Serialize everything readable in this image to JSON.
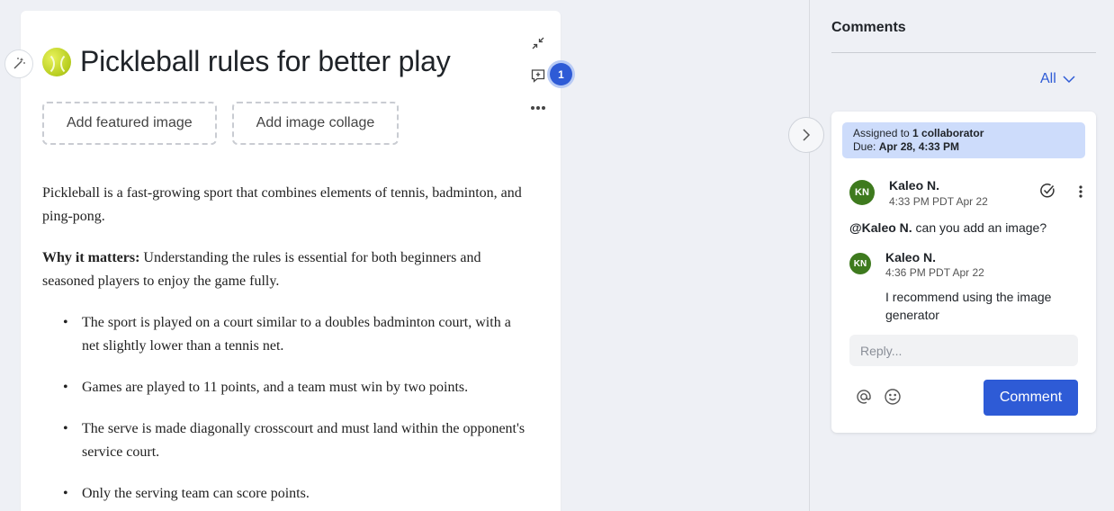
{
  "editor": {
    "title": "Pickleball rules for better play",
    "add_featured_image": "Add featured image",
    "add_image_collage": "Add image collage",
    "comment_count": "1",
    "intro": "Pickleball is a fast-growing sport that combines elements of tennis, badminton, and ping-pong.",
    "why_label": "Why it matters:",
    "why_text": " Understanding the rules is essential for both beginners and seasoned players to enjoy the game fully.",
    "bullets": [
      "The sport is played on a court similar to a doubles badminton court, with a net slightly lower than a tennis net.",
      "Games are played to 11 points, and a team must win by two points.",
      "The serve is made diagonally crosscourt and must land within the opponent's service court.",
      "Only the serving team can score points."
    ]
  },
  "comments": {
    "title": "Comments",
    "filter": "All",
    "assignment": {
      "prefix": "Assigned to ",
      "collaborators": "1 collaborator",
      "due_label": "Due: ",
      "due_date": "Apr 28, 4:33 PM"
    },
    "thread": [
      {
        "initials": "KN",
        "author": "Kaleo N.",
        "time": "4:33 PM PDT Apr 22",
        "mention": "@Kaleo N.",
        "text": " can you add an image?"
      },
      {
        "initials": "KN",
        "author": "Kaleo N.",
        "time": "4:36 PM PDT Apr 22",
        "text": "I recommend using the image generator"
      }
    ],
    "reply_placeholder": "Reply...",
    "submit_label": "Comment"
  },
  "colors": {
    "accent": "#2e5bd6",
    "avatar": "#3e7a1e",
    "assign_bg": "#cddcfb"
  },
  "icons": [
    "magic-wand-icon",
    "pickleball-icon",
    "collapse-icon",
    "add-comment-icon",
    "more-horizontal-icon",
    "chevron-right-icon",
    "chevron-down-icon",
    "resolve-check-icon",
    "more-vertical-icon",
    "at-mention-icon",
    "emoji-icon"
  ]
}
